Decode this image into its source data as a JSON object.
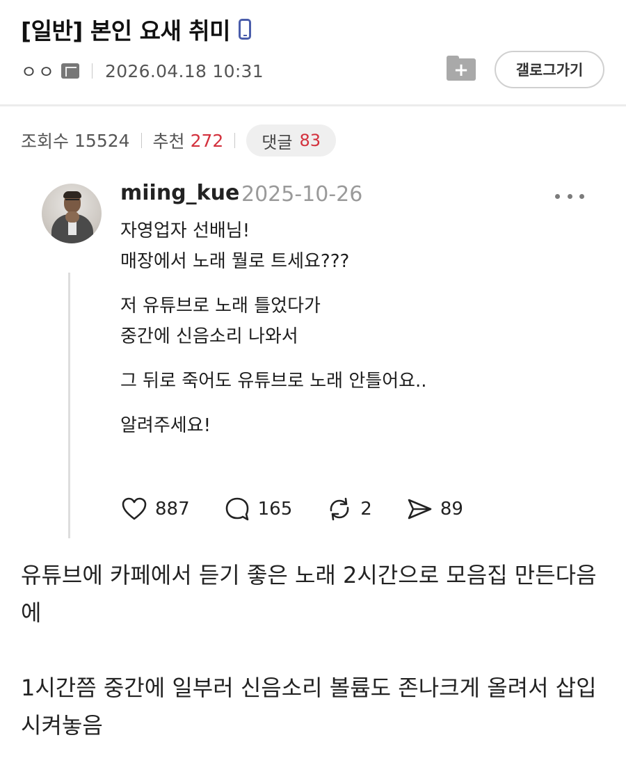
{
  "post": {
    "title": "[일반] 본인 요새 취미",
    "author": "ㅇㅇ",
    "date": "2026.04.18 10:31",
    "gallery_button": "갤로그가기"
  },
  "stats": {
    "views_label": "조회수",
    "views": "15524",
    "recommend_label": "추천",
    "recommend": "272",
    "comments_label": "댓글",
    "comments": "83"
  },
  "embed": {
    "username": "miing_kue",
    "date": "2025-10-26",
    "paragraphs": [
      "자영업자 선배님!\n매장에서 노래 뭘로 트세요???",
      "저 유튜브로 노래 틀었다가\n중간에 신음소리 나와서",
      "그 뒤로 죽어도 유튜브로 노래 안틀어요..",
      "알려주세요!"
    ],
    "actions": {
      "likes": "887",
      "replies": "165",
      "reposts": "2",
      "shares": "89"
    }
  },
  "body": {
    "para1": "유튜브에 카페에서 듣기 좋은 노래 2시간으로 모음집 만든다음에",
    "para2": "1시간쯤 중간에 일부러 신음소리 볼륨도 존나크게 올려서 삽입시켜놓음"
  },
  "colors": {
    "accent_red": "#d3313d",
    "phone_icon": "#4a5dab"
  }
}
